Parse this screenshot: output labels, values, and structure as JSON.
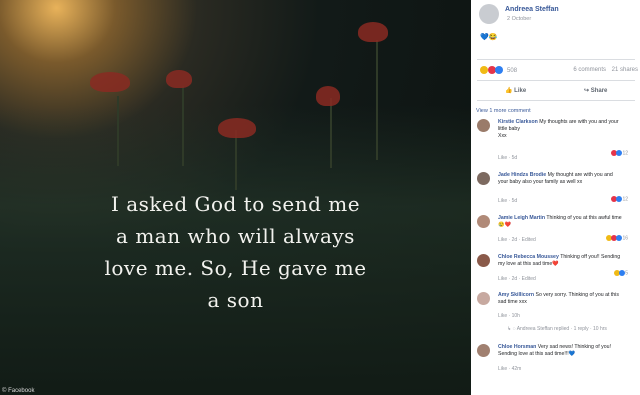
{
  "image": {
    "quote_lines": "I asked God to send me\na man who will always\nlove me. So, He gave me\na son",
    "credit": "© Facebook"
  },
  "post": {
    "author": "Andreea Steffan",
    "date": "2 October",
    "emoji_text": "💙😂",
    "reactions_count": "508",
    "comments_count": "6 comments",
    "shares_count": "21 shares",
    "like_label": "Like",
    "share_label": "Share",
    "view_more": "View 1 more comment"
  },
  "colors": {
    "link": "#385898",
    "muted": "#90949c",
    "like_blue": "#2e7ff1",
    "love_red": "#e5344a",
    "sad_yellow": "#f0ba15"
  },
  "comments": [
    {
      "name": "Kirstie Clarkson",
      "text": "My thoughts are with you and your little baby",
      "extra": "Xxx",
      "meta": "Like · 5d",
      "count": "12"
    },
    {
      "name": "Jade Hindzs Brodie",
      "text": "My thought are with you and your baby also your family as well xx",
      "meta": "Like · 5d",
      "count": "12"
    },
    {
      "name": "Jamie Leigh Martin",
      "text": "Thinking of you at this awful time 😢❤️",
      "meta": "Like · 2d · Edited",
      "count": "16"
    },
    {
      "name": "Chloe Rebecca Moussey",
      "text": "Thinking off you!! Sending my love at this sad time❤️",
      "meta": "Like · 2d · Edited",
      "count": "5"
    },
    {
      "name": "Amy Skillicorn",
      "text": "So very sorry. Thinking of you at this sad time xxx",
      "meta": "Like · 10h"
    },
    {
      "name": "Chloe Horsman",
      "text": "Very sad news! Thinking of you! Sending love at this sad time!!!💙",
      "meta": "Like · 42m"
    }
  ],
  "reply": {
    "text": "Andreea Steffan replied · 1 reply · 10 hrs"
  }
}
